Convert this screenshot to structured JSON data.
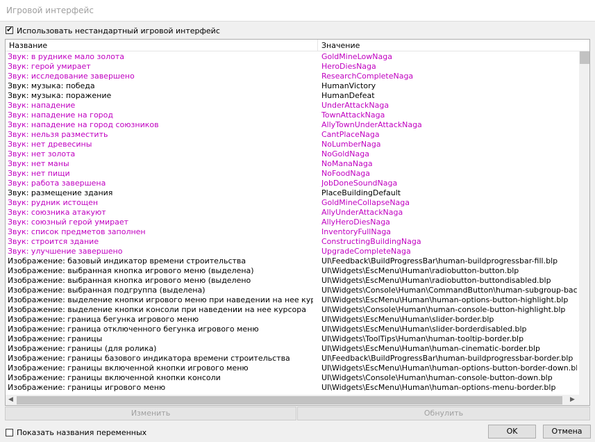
{
  "window": {
    "title": "Игровой интерфейс"
  },
  "use_custom": {
    "label": "Использовать нестандартный игровой интерфейс",
    "checked": true
  },
  "list": {
    "columns": [
      "Название",
      "Значение"
    ],
    "rows": [
      {
        "name": "Звук: в руднике мало золота",
        "value": "GoldMineLowNaga",
        "custom": true
      },
      {
        "name": "Звук: герой умирает",
        "value": "HeroDiesNaga",
        "custom": true
      },
      {
        "name": "Звук: исследование завершено",
        "value": "ResearchCompleteNaga",
        "custom": true
      },
      {
        "name": "Звук: музыка: победа",
        "value": "HumanVictory",
        "custom": false
      },
      {
        "name": "Звук: музыка: поражение",
        "value": "HumanDefeat",
        "custom": false
      },
      {
        "name": "Звук: нападение",
        "value": "UnderAttackNaga",
        "custom": true
      },
      {
        "name": "Звук: нападение на город",
        "value": "TownAttackNaga",
        "custom": true
      },
      {
        "name": "Звук: нападение на город союзников",
        "value": "AllyTownUnderAttackNaga",
        "custom": true
      },
      {
        "name": "Звук: нельзя разместить",
        "value": "CantPlaceNaga",
        "custom": true
      },
      {
        "name": "Звук: нет древесины",
        "value": "NoLumberNaga",
        "custom": true
      },
      {
        "name": "Звук: нет золота",
        "value": "NoGoldNaga",
        "custom": true
      },
      {
        "name": "Звук: нет маны",
        "value": "NoManaNaga",
        "custom": true
      },
      {
        "name": "Звук: нет пищи",
        "value": "NoFoodNaga",
        "custom": true
      },
      {
        "name": "Звук: работа завершена",
        "value": "JobDoneSoundNaga",
        "custom": true
      },
      {
        "name": "Звук: размещение здания",
        "value": "PlaceBuildingDefault",
        "custom": false
      },
      {
        "name": "Звук: рудник истощен",
        "value": "GoldMineCollapseNaga",
        "custom": true
      },
      {
        "name": "Звук: союзника атакуют",
        "value": "AllyUnderAttackNaga",
        "custom": true
      },
      {
        "name": "Звук: союзный герой умирает",
        "value": "AllyHeroDiesNaga",
        "custom": true
      },
      {
        "name": "Звук: список предметов заполнен",
        "value": "InventoryFullNaga",
        "custom": true
      },
      {
        "name": "Звук: строится здание",
        "value": "ConstructingBuildingNaga",
        "custom": true
      },
      {
        "name": "Звук: улучшение завершено",
        "value": "UpgradeCompleteNaga",
        "custom": true
      },
      {
        "name": "Изображение: базовый индикатор времени строительства",
        "value": "UI\\Feedback\\BuildProgressBar\\human-buildprogressbar-fill.blp",
        "custom": false
      },
      {
        "name": "Изображение: выбранная кнопка игрового меню (выделена)",
        "value": "UI\\Widgets\\EscMenu\\Human\\radiobutton-button.blp",
        "custom": false
      },
      {
        "name": "Изображение: выбранная кнопка игрового меню (выделено",
        "value": "UI\\Widgets\\EscMenu\\Human\\radiobutton-buttondisabled.blp",
        "custom": false
      },
      {
        "name": "Изображение: выбранная подгруппа (выделена)",
        "value": "UI\\Widgets\\Console\\Human\\CommandButton\\human-subgroup-backgroun...",
        "custom": false
      },
      {
        "name": "Изображение: выделение кнопки игрового меню при наведении на нее курсора",
        "value": "UI\\Widgets\\EscMenu\\Human\\human-options-button-highlight.blp",
        "custom": false
      },
      {
        "name": "Изображение: выделение кнопки консоли при наведении на нее курсора",
        "value": "UI\\Widgets\\Console\\Human\\human-console-button-highlight.blp",
        "custom": false
      },
      {
        "name": "Изображение: граница бегунка игрового меню",
        "value": "UI\\Widgets\\EscMenu\\Human\\slider-border.blp",
        "custom": false
      },
      {
        "name": "Изображение: граница отключенного бегунка игрового меню",
        "value": "UI\\Widgets\\EscMenu\\Human\\slider-borderdisabled.blp",
        "custom": false
      },
      {
        "name": "Изображение: границы",
        "value": "UI\\Widgets\\ToolTips\\Human\\human-tooltip-border.blp",
        "custom": false
      },
      {
        "name": "Изображение: границы (для ролика)",
        "value": "UI\\Widgets\\EscMenu\\Human\\human-cinematic-border.blp",
        "custom": false
      },
      {
        "name": "Изображение: границы базового индикатора времени строительства",
        "value": "UI\\Feedback\\BuildProgressBar\\human-buildprogressbar-border.blp",
        "custom": false
      },
      {
        "name": "Изображение: границы включенной кнопки игрового меню",
        "value": "UI\\Widgets\\EscMenu\\Human\\human-options-button-border-down.blp",
        "custom": false
      },
      {
        "name": "Изображение: границы включенной кнопки консоли",
        "value": "UI\\Widgets\\Console\\Human\\human-console-button-down.blp",
        "custom": false
      },
      {
        "name": "Изображение: границы игрового меню",
        "value": "UI\\Widgets\\EscMenu\\Human\\human-options-menu-border.blp",
        "custom": false
      }
    ]
  },
  "buttons": {
    "change": "Изменить",
    "reset": "Обнулить",
    "ok": "OK",
    "cancel": "Отмена"
  },
  "show_var_names": {
    "label": "Показать названия переменных",
    "checked": false
  },
  "colors": {
    "custom_text": "#c000c0",
    "default_text": "#000000"
  }
}
